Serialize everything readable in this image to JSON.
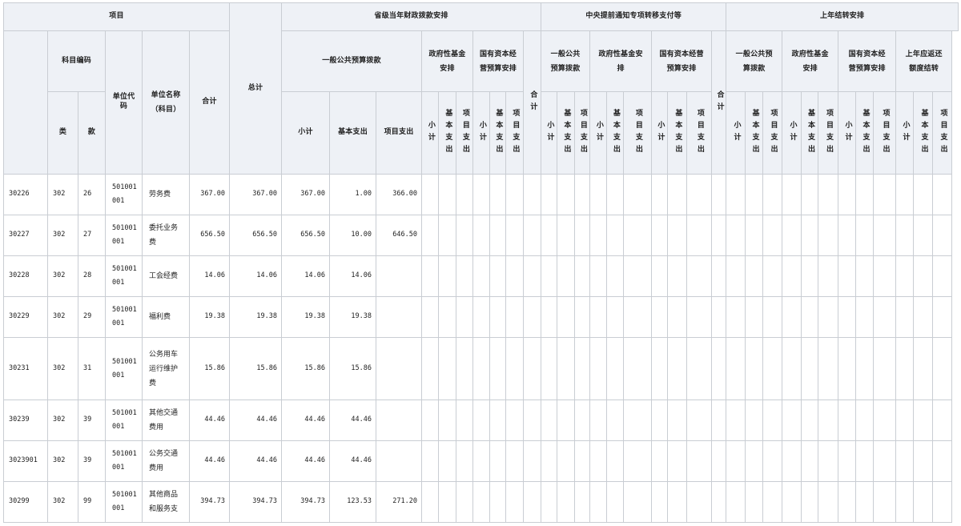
{
  "header": {
    "xiangmu": "项目",
    "sheng_group": "省级当年财政拨款安排",
    "zhongyang_group": "中央提前通知专项转移支付等",
    "shangnian_group": "上年结转安排",
    "kemu_bianma": "科目编码",
    "danwei_daima": "单位代码",
    "danwei_mingcheng": "单位名称（科目）",
    "zongji": "总计",
    "heji": "合计",
    "ybgg_yusuan": "一般公共预算拨款",
    "zfx_jijin": "政府性基金安排",
    "gyzb_jingying": "国有资本经营预算安排",
    "zy_heji": "合计",
    "zy_ybgg": "一般公共预算拨款",
    "zy_zfx": "政府性基金安排",
    "zy_gyzb": "国有资本经营预算安排",
    "sn_heji": "合计",
    "sn_ybgg": "一般公共预算拨款",
    "sn_zfx": "政府性基金安排",
    "sn_gyzb": "国有资本经营预算安排",
    "sn_fanhuan": "上年应返还额度结转",
    "lei": "类",
    "kuan": "款",
    "xiaoji": "小计",
    "jiben": "基本支出",
    "xiangmu_zc": "项目支出"
  },
  "rows": [
    {
      "code": "30226",
      "lei": "302",
      "kuan": "26",
      "unit": [
        "501001",
        "001"
      ],
      "name": [
        "劳务费"
      ],
      "total": "367.00",
      "heji": "367.00",
      "xiaoji": "367.00",
      "jiben": "1.00",
      "xiangmu": "366.00"
    },
    {
      "code": "30227",
      "lei": "302",
      "kuan": "27",
      "unit": [
        "501001",
        "001"
      ],
      "name": [
        "委托业务",
        "费"
      ],
      "total": "656.50",
      "heji": "656.50",
      "xiaoji": "656.50",
      "jiben": "10.00",
      "xiangmu": "646.50"
    },
    {
      "code": "30228",
      "lei": "302",
      "kuan": "28",
      "unit": [
        "501001",
        "001"
      ],
      "name": [
        "工会经费"
      ],
      "total": "14.06",
      "heji": "14.06",
      "xiaoji": "14.06",
      "jiben": "14.06",
      "xiangmu": ""
    },
    {
      "code": "30229",
      "lei": "302",
      "kuan": "29",
      "unit": [
        "501001",
        "001"
      ],
      "name": [
        "福利费"
      ],
      "total": "19.38",
      "heji": "19.38",
      "xiaoji": "19.38",
      "jiben": "19.38",
      "xiangmu": ""
    },
    {
      "code": "30231",
      "lei": "302",
      "kuan": "31",
      "unit": [
        "501001",
        "001"
      ],
      "name": [
        "公务用车",
        "运行维护",
        "费"
      ],
      "total": "15.86",
      "heji": "15.86",
      "xiaoji": "15.86",
      "jiben": "15.86",
      "xiangmu": ""
    },
    {
      "code": "30239",
      "lei": "302",
      "kuan": "39",
      "unit": [
        "501001",
        "001"
      ],
      "name": [
        "其他交通",
        "费用"
      ],
      "total": "44.46",
      "heji": "44.46",
      "xiaoji": "44.46",
      "jiben": "44.46",
      "xiangmu": ""
    },
    {
      "code": "3023901",
      "lei": "302",
      "kuan": "39",
      "unit": [
        "501001",
        "001"
      ],
      "name": [
        "公务交通",
        "费用"
      ],
      "total": "44.46",
      "heji": "44.46",
      "xiaoji": "44.46",
      "jiben": "44.46",
      "xiangmu": ""
    },
    {
      "code": "30299",
      "lei": "302",
      "kuan": "99",
      "unit": [
        "501001",
        "001"
      ],
      "name": [
        "其他商品",
        "和服务支"
      ],
      "total": "394.73",
      "heji": "394.73",
      "xiaoji": "394.73",
      "jiben": "123.53",
      "xiangmu": "271.20"
    }
  ]
}
